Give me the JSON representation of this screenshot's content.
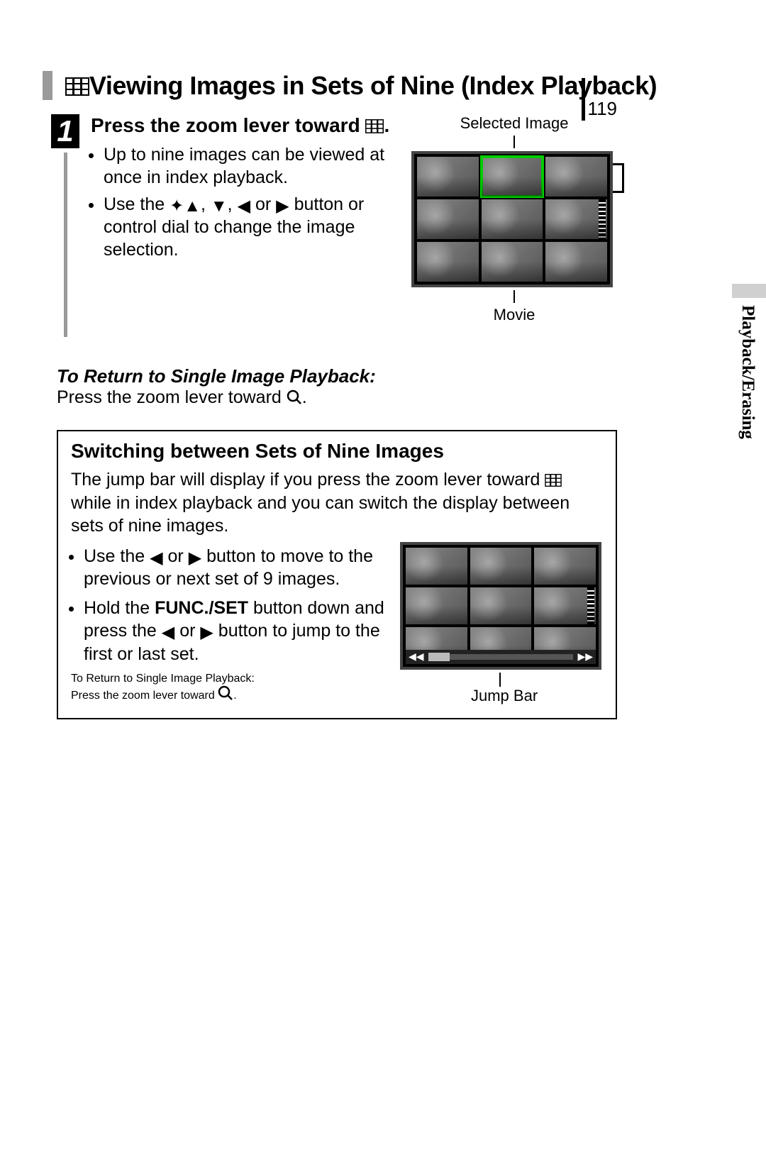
{
  "page_number": "119",
  "side_tab": "Playback/Erasing",
  "title": "Viewing Images in Sets of Nine (Index Playback)",
  "step": {
    "number": "1",
    "heading_a": "Press the zoom lever toward ",
    "heading_b": ".",
    "bullet1": "Up to nine images can be viewed at once in index playback.",
    "bullet2_a": "Use the ",
    "bullet2_b": " button or control dial to change the image selection.",
    "sep": ", ",
    "or": " or "
  },
  "thumb_labels": {
    "selected": "Selected Image",
    "movie": "Movie",
    "jump_bar": "Jump Bar"
  },
  "return": {
    "heading": "To Return to Single Image Playback:",
    "body_a": "Press the zoom lever toward ",
    "body_b": "."
  },
  "box": {
    "heading": "Switching between Sets of Nine Images",
    "intro_a": "The jump bar will display if you press the zoom lever toward ",
    "intro_b": " while in index playback and you can switch the display between sets of nine images.",
    "b1_a": "Use the ",
    "b1_b": " button to move to the previous or next set of 9 images.",
    "b2_a": "Hold the ",
    "b2_bold": "FUNC./SET",
    "b2_b": " button down and press the ",
    "b2_c": " button to jump to the first or last set.",
    "ret_a": "To Return to Single Image Playback:",
    "ret_b": "Press the zoom lever toward ",
    "ret_c": ".",
    "or": " or "
  }
}
